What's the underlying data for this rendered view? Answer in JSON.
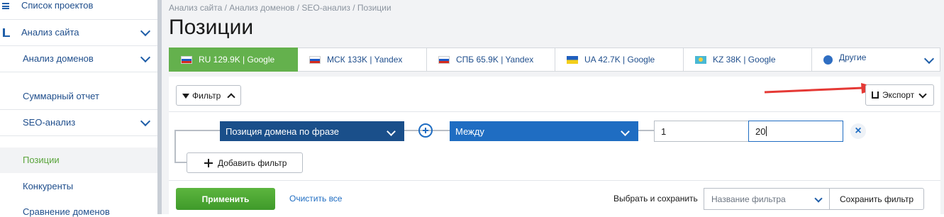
{
  "sidebar": {
    "items": [
      {
        "label": "Список проектов"
      },
      {
        "label": "Анализ сайта"
      },
      {
        "label": "Анализ доменов"
      },
      {
        "label": "Суммарный отчет"
      },
      {
        "label": "SEO-анализ"
      },
      {
        "label": "Позиции"
      },
      {
        "label": "Конкуренты"
      },
      {
        "label": "Сравнение доменов"
      }
    ]
  },
  "breadcrumb": "Анализ сайта / Анализ доменов / SEO-анализ / Позиции",
  "page_title": "Позиции",
  "tabs": [
    {
      "label": "RU 129.9K | Google"
    },
    {
      "label": "МСК 133K | Yandex"
    },
    {
      "label": "СПБ 65.9K | Yandex"
    },
    {
      "label": "UA 42.7K | Google"
    },
    {
      "label": "KZ 38K | Google"
    },
    {
      "label": "Другие"
    }
  ],
  "toolbar": {
    "filter_label": "Фильтр",
    "export_label": "Экспорт"
  },
  "filter": {
    "field": "Позиция домена по фразе",
    "operator": "Между",
    "value_from": "1",
    "value_to": "20",
    "add_label": "Добавить фильтр"
  },
  "footer": {
    "apply_label": "Применить",
    "clear_label": "Очистить все",
    "save_prompt": "Выбрать и сохранить",
    "filter_name_placeholder": "Название фильтра",
    "save_label": "Сохранить фильтр"
  },
  "colors": {
    "accent_green": "#64b14d",
    "dark_blue": "#1a4f8a",
    "blue": "#1f6dc2",
    "annotation_red": "#e53935"
  }
}
